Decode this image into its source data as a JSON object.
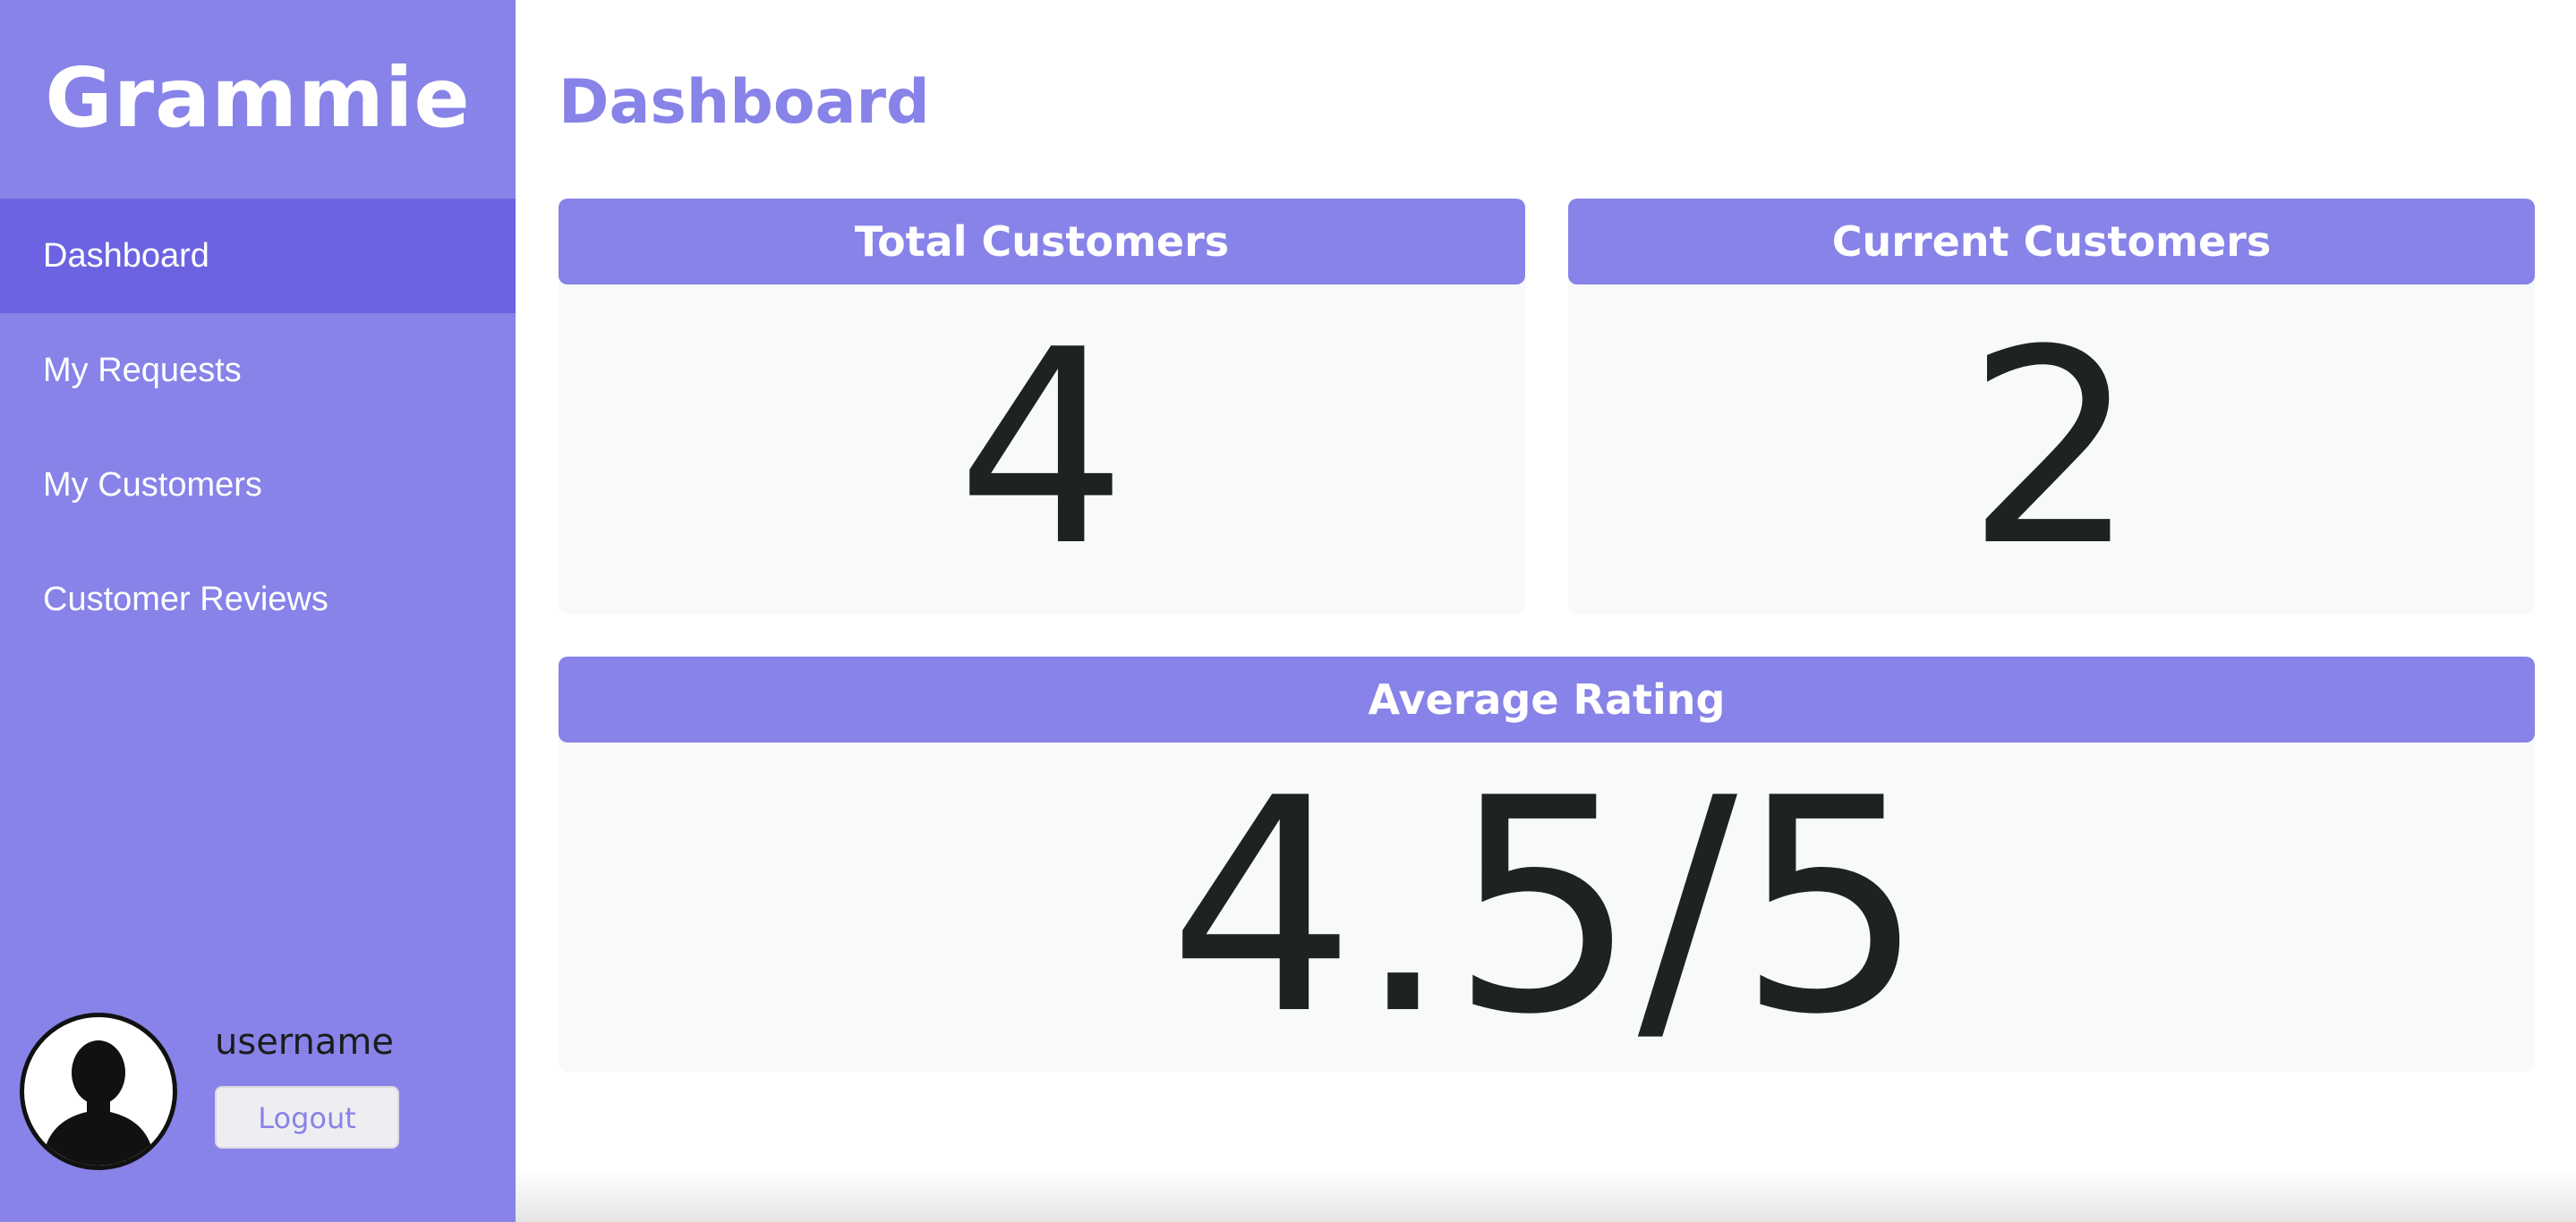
{
  "app": {
    "brand": "Grammie",
    "accent_color": "#8783e8",
    "active_nav_color": "#6c63e2"
  },
  "sidebar": {
    "items": [
      {
        "label": "Dashboard",
        "active": true
      },
      {
        "label": "My Requests",
        "active": false
      },
      {
        "label": "My Customers",
        "active": false
      },
      {
        "label": "Customer Reviews",
        "active": false
      }
    ],
    "user": {
      "avatar_icon": "user-silhouette-icon",
      "username": "username",
      "logout_label": "Logout"
    }
  },
  "main": {
    "title": "Dashboard",
    "cards": {
      "total_customers": {
        "label": "Total Customers",
        "value": "4"
      },
      "current_customers": {
        "label": "Current Customers",
        "value": "2"
      },
      "average_rating": {
        "label": "Average Rating",
        "value": "4.5/5"
      }
    }
  }
}
